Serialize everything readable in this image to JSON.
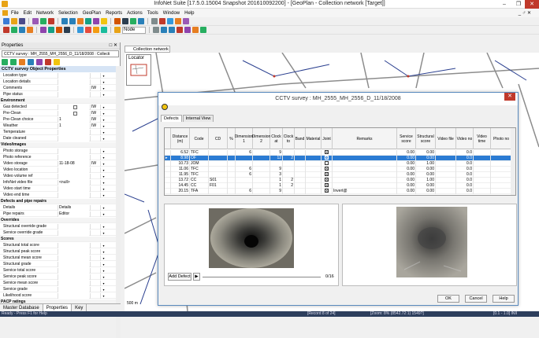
{
  "window": {
    "title": "InfoNet Suite [17.5.0.15004 Snapshot 201610092200] - [GeoPlan - Collection network [Target]]",
    "min": "–",
    "max": "❐",
    "close": "✕",
    "mdi_controls": "_ ♂ ✕"
  },
  "menu": [
    "File",
    "Edit",
    "Network",
    "Selection",
    "GeoPlan",
    "Reports",
    "Actions",
    "Tools",
    "Window",
    "Help"
  ],
  "toolbar": {
    "node_dropdown": "Node"
  },
  "properties": {
    "header": "Properties",
    "header_controls": "□ ✕",
    "combo": "CCTV survey : MH_2555_MH_2556_D_11/18/2008 : Collecti",
    "title": "CCTV survey Object Properties",
    "rows": [
      {
        "k": "Location type",
        "v": "",
        "f": ""
      },
      {
        "k": "Location details",
        "v": "",
        "f": ""
      },
      {
        "k": "Comments",
        "v": "",
        "f": "IW"
      },
      {
        "k": "Pipe status",
        "v": "",
        "f": ""
      },
      {
        "k": "Environment",
        "section": true
      },
      {
        "k": "Gas detected",
        "v": "",
        "f": "IW",
        "cb": true
      },
      {
        "k": "Pre-Clean",
        "v": "",
        "f": "IW",
        "cb": true
      },
      {
        "k": "Pre-Clean choice",
        "v": "1",
        "f": "IW"
      },
      {
        "k": "Weather",
        "v": "1",
        "f": "IW"
      },
      {
        "k": "Temperature",
        "v": "",
        "f": ""
      },
      {
        "k": "Date cleaned",
        "v": "",
        "f": ""
      },
      {
        "k": "Video/images",
        "section": true
      },
      {
        "k": "Photo storage",
        "v": "",
        "f": ""
      },
      {
        "k": "Photo reference",
        "v": "",
        "f": ""
      },
      {
        "k": "Video storage",
        "v": "11-18-08",
        "f": "IW"
      },
      {
        "k": "Video location",
        "v": "",
        "f": ""
      },
      {
        "k": "Video volume ref",
        "v": "",
        "f": ""
      },
      {
        "k": "InfoNet video file",
        "v": "<null>",
        "f": ""
      },
      {
        "k": "Video start time",
        "v": "",
        "f": ""
      },
      {
        "k": "Video end time",
        "v": "",
        "f": ""
      },
      {
        "k": "Defects and pipe repairs",
        "section": true
      },
      {
        "k": "Details",
        "v": "Details",
        "f": ""
      },
      {
        "k": "Pipe repairs",
        "v": "Editor",
        "f": ""
      },
      {
        "k": "Overrides",
        "section": true
      },
      {
        "k": "Structural override grade",
        "v": "",
        "f": ""
      },
      {
        "k": "Service override grade",
        "v": "",
        "f": ""
      },
      {
        "k": "Scores",
        "section": true
      },
      {
        "k": "Structural total score",
        "v": "",
        "f": ""
      },
      {
        "k": "Structural peak score",
        "v": "",
        "f": ""
      },
      {
        "k": "Structural mean score",
        "v": "",
        "f": ""
      },
      {
        "k": "Structural grade",
        "v": "",
        "f": ""
      },
      {
        "k": "Service total score",
        "v": "",
        "f": ""
      },
      {
        "k": "Service peak score",
        "v": "",
        "f": ""
      },
      {
        "k": "Service mean score",
        "v": "",
        "f": ""
      },
      {
        "k": "Service grade",
        "v": "",
        "f": ""
      },
      {
        "k": "Likelihood score",
        "v": "",
        "f": ""
      },
      {
        "k": "PACP ratings",
        "section": true
      }
    ],
    "tabs": [
      "Master Database",
      "Properties",
      "Key"
    ]
  },
  "doc_tab": "Collection network",
  "locator": "Locator",
  "map": {
    "scale": "500 m"
  },
  "dialog": {
    "title": "CCTV survey : MH_2555_MH_2556_D_11/18/2008",
    "tabs": [
      "Defects",
      "Internal View"
    ],
    "columns": [
      "Distance (m)",
      "Code",
      "CD",
      "%",
      "Dimension 1",
      "Dimension 2",
      "Clock at",
      "Clock to",
      "Band",
      "Material",
      "Joint",
      "Remarks",
      "Service score",
      "Structural score",
      "Video file",
      "Video no",
      "Video time",
      "Photo no"
    ],
    "rows": [
      {
        "dist": "6.52",
        "code": "TFC",
        "cd": "",
        "pct": "",
        "d1": "6",
        "d2": "",
        "ca": "9",
        "ct": "",
        "joint": true,
        "rem": "",
        "ss": "0.00",
        "st": "0.00",
        "vn": "0.0",
        "sel": false
      },
      {
        "dist": "8.98",
        "code": "OF",
        "cd": "",
        "pct": "",
        "d1": "",
        "d2": "",
        "ca": "12",
        "ct": "2",
        "joint": true,
        "rem": "",
        "ss": "0.00",
        "st": "0.00",
        "vn": "0.0",
        "sel": true
      },
      {
        "dist": "10.73",
        "code": "JOM",
        "cd": "",
        "pct": "",
        "d1": "",
        "d2": "",
        "ca": "",
        "ct": "",
        "joint": false,
        "rem": "",
        "ss": "0.00",
        "st": "1.00",
        "vn": "0.0",
        "sel": false
      },
      {
        "dist": "11.06",
        "code": "TFC",
        "cd": "",
        "pct": "",
        "d1": "6",
        "d2": "",
        "ca": "9",
        "ct": "",
        "joint": true,
        "rem": "",
        "ss": "0.00",
        "st": "0.00",
        "vn": "0.0",
        "sel": false
      },
      {
        "dist": "11.95",
        "code": "TFC",
        "cd": "",
        "pct": "",
        "d1": "6",
        "d2": "",
        "ca": "3",
        "ct": "",
        "joint": true,
        "rem": "",
        "ss": "0.00",
        "st": "0.00",
        "vn": "0.0",
        "sel": false
      },
      {
        "dist": "13.72",
        "code": "CC",
        "cd": "S01",
        "pct": "",
        "d1": "",
        "d2": "",
        "ca": "1",
        "ct": "2",
        "joint": true,
        "rem": "",
        "ss": "0.00",
        "st": "1.00",
        "vn": "0.0",
        "sel": false
      },
      {
        "dist": "14.45",
        "code": "CC",
        "cd": "F01",
        "pct": "",
        "d1": "",
        "d2": "",
        "ca": "1",
        "ct": "2",
        "joint": true,
        "rem": "",
        "ss": "0.00",
        "st": "0.00",
        "vn": "0.0",
        "sel": false
      },
      {
        "dist": "20.15",
        "code": "TFA",
        "cd": "",
        "pct": "",
        "d1": "6",
        "d2": "",
        "ca": "9",
        "ct": "",
        "joint": true,
        "rem": "Invert@",
        "ss": "0.00",
        "st": "0.00",
        "vn": "0.0",
        "sel": false
      }
    ],
    "add_defect": "Add Defect",
    "counter": "0/16",
    "ok": "OK",
    "cancel": "Cancel",
    "help": "Help"
  },
  "status": {
    "left": "Ready - Press F1 for Help",
    "record": "[Record 8 of 24]",
    "zoom": "[Zoom: 8% (8542.72:1) 1549?]",
    "xy": "[0.1 - 1.0] INII"
  }
}
